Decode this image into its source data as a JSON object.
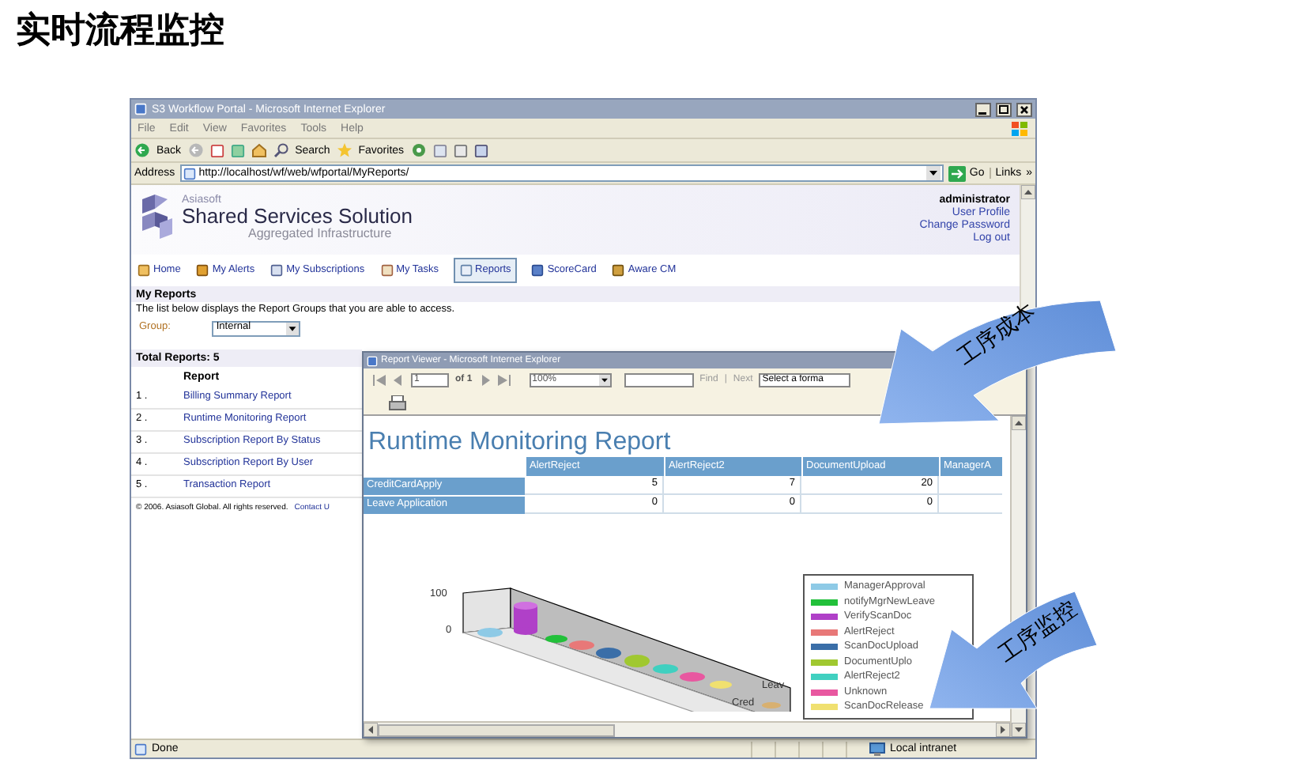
{
  "page_title": "实时流程监控",
  "browser": {
    "title": "S3 Workflow Portal - Microsoft Internet Explorer",
    "menu": [
      "File",
      "Edit",
      "View",
      "Favorites",
      "Tools",
      "Help"
    ],
    "toolbar": {
      "back": "Back",
      "search": "Search",
      "favorites": "Favorites"
    },
    "address": {
      "label": "Address",
      "url": "http://localhost/wf/web/wfportal/MyReports/",
      "go": "Go",
      "links": "Links",
      "more": "»"
    },
    "status": {
      "text": "Done",
      "zone": "Local intranet"
    }
  },
  "portal": {
    "brand": {
      "company": "Asiasoft",
      "product": "Shared Services Solution",
      "tagline": "Aggregated Infrastructure"
    },
    "user": {
      "name": "administrator",
      "links": [
        "User Profile",
        "Change Password",
        "Log out"
      ]
    },
    "nav": [
      {
        "label": "Home",
        "selected": false
      },
      {
        "label": "My Alerts",
        "selected": false
      },
      {
        "label": "My Subscriptions",
        "selected": false
      },
      {
        "label": "My Tasks",
        "selected": false
      },
      {
        "label": "Reports",
        "selected": true
      },
      {
        "label": "ScoreCard",
        "selected": false
      },
      {
        "label": "Aware CM",
        "selected": false
      }
    ],
    "section_title": "My Reports",
    "description": "The list below displays the Report Groups that you are able to access.",
    "group": {
      "label": "Group:",
      "value": "Internal"
    },
    "total": "Total Reports: 5",
    "column": "Report",
    "reports": [
      {
        "number": "1 .",
        "name": "Billing Summary Report"
      },
      {
        "number": "2 .",
        "name": "Runtime Monitoring Report"
      },
      {
        "number": "3 .",
        "name": "Subscription Report By Status"
      },
      {
        "number": "4 .",
        "name": "Subscription Report By User"
      },
      {
        "number": "5 .",
        "name": "Transaction Report"
      }
    ],
    "footer": {
      "text": "© 2006. Asiasoft Global. All rights reserved.",
      "link": "Contact U"
    }
  },
  "report_viewer": {
    "title": "Report Viewer - Microsoft Internet Explorer",
    "page": "1",
    "of": "of 1",
    "zoom": "100%",
    "find": "Find",
    "separator": "|",
    "next": "Next",
    "format": "Select a forma",
    "report_title": "Runtime Monitoring Report",
    "columns": [
      "AlertReject",
      "AlertReject2",
      "DocumentUpload",
      "ManagerA"
    ],
    "rows": [
      {
        "label": "CreditCardApply",
        "values": [
          "5",
          "7",
          "20"
        ]
      },
      {
        "label": "Leave Application",
        "values": [
          "0",
          "0",
          "0"
        ]
      }
    ],
    "chart": {
      "yticks": [
        "100",
        "0"
      ],
      "categories": [
        "Cred",
        "Leav"
      ],
      "legend": [
        {
          "label": "ManagerApproval",
          "color": "#8ecae6"
        },
        {
          "label": "notifyMgrNewLeave",
          "color": "#22c03a"
        },
        {
          "label": "VerifyScanDoc",
          "color": "#b040c8"
        },
        {
          "label": "AlertReject",
          "color": "#e87878"
        },
        {
          "label": "ScanDocUpload",
          "color": "#3a6ea8"
        },
        {
          "label": "DocumentUplo",
          "color": "#a0c830"
        },
        {
          "label": "AlertReject2",
          "color": "#40d0c0"
        },
        {
          "label": "Unknown",
          "color": "#e858a0"
        },
        {
          "label": "ScanDocRelease",
          "color": "#f0e070"
        }
      ]
    }
  },
  "annotations": [
    {
      "text": "工序成本"
    },
    {
      "text": "工序监控"
    }
  ]
}
